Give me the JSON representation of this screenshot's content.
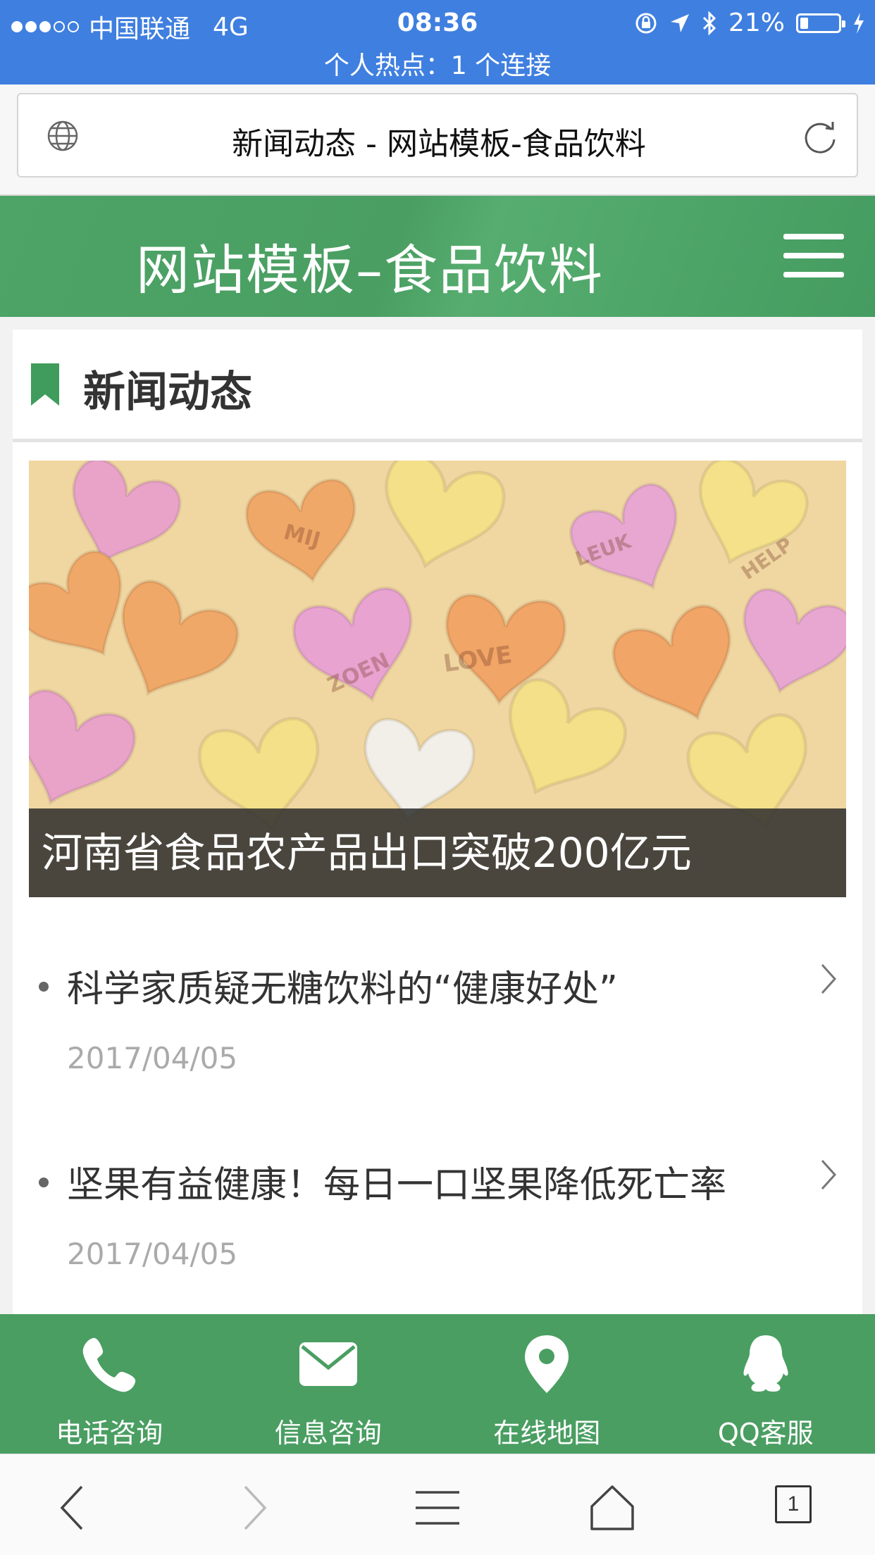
{
  "status_bar": {
    "carrier": "中国联通",
    "network": "4G",
    "time": "08:36",
    "battery": "21%",
    "battery_level": 0.21,
    "hotspot": "个人热点：1 个连接"
  },
  "address_bar": {
    "page_title": "新闻动态 - 网站模板-食品饮料"
  },
  "site_header": {
    "title": "网站模板–食品饮料"
  },
  "section": {
    "title": "新闻动态"
  },
  "featured": {
    "caption": "河南省食品农产品出口突破200亿元"
  },
  "news": [
    {
      "title": "科学家质疑无糖饮料的“健康好处”",
      "date": "2017/04/05"
    },
    {
      "title": "坚果有益健康！每日一口坚果降低死亡率",
      "date": "2017/04/05"
    }
  ],
  "contact_bar": [
    {
      "label": "电话咨询",
      "icon": "phone-icon"
    },
    {
      "label": "信息咨询",
      "icon": "mail-icon"
    },
    {
      "label": "在线地图",
      "icon": "map-pin-icon"
    },
    {
      "label": "QQ客服",
      "icon": "qq-icon"
    }
  ],
  "toolbar": {
    "tab_count": "1"
  },
  "colors": {
    "status_bar": "#3f7fe0",
    "brand_green": "#4a9e62"
  }
}
